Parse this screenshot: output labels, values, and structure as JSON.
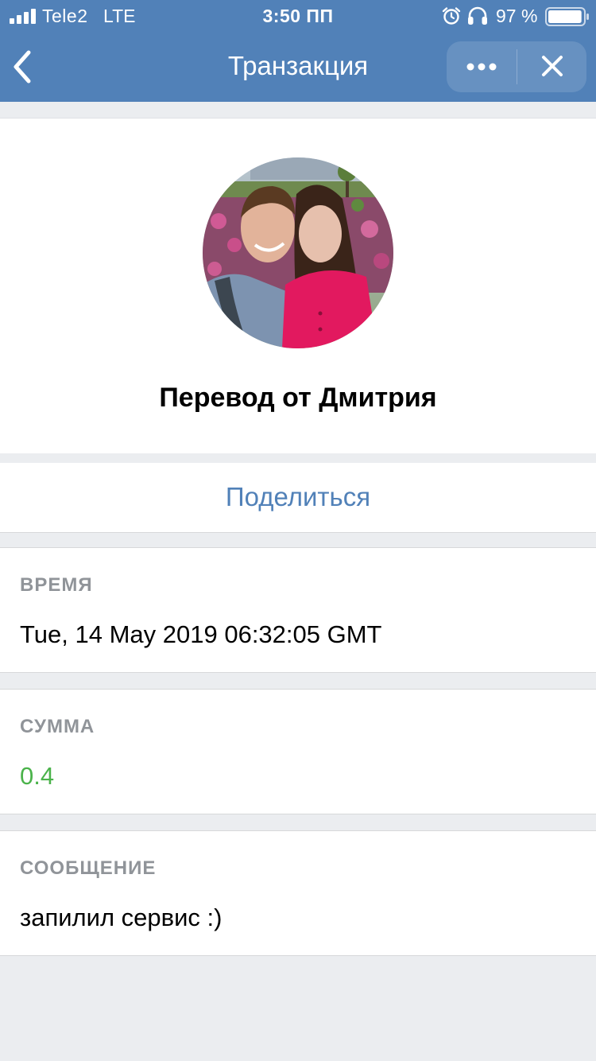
{
  "status_bar": {
    "carrier": "Tele2",
    "network": "LTE",
    "time": "3:50 ПП",
    "battery": "97 %",
    "battery_level": 0.97,
    "icons": [
      "signal-icon",
      "alarm-icon",
      "headphones-icon",
      "battery-icon"
    ]
  },
  "nav": {
    "title": "Транзакция",
    "back_icon": "chevron-left-icon",
    "more_icon": "more-dots-icon",
    "close_icon": "close-icon"
  },
  "profile": {
    "avatar": "profile-photo",
    "name": "Перевод от Дмитрия"
  },
  "share": {
    "label": "Поделиться"
  },
  "details": {
    "time": {
      "label": "ВРЕМЯ",
      "value": "Tue, 14 May 2019 06:32:05 GMT"
    },
    "amount": {
      "label": "СУММА",
      "value": "0.4",
      "color": "#4bb34b"
    },
    "message": {
      "label": "СООБЩЕНИЕ",
      "value": "запилил сервис :)"
    }
  },
  "colors": {
    "header": "#5181b8",
    "accent": "#5181b8",
    "background": "#ebedf0",
    "positive": "#4bb34b"
  }
}
